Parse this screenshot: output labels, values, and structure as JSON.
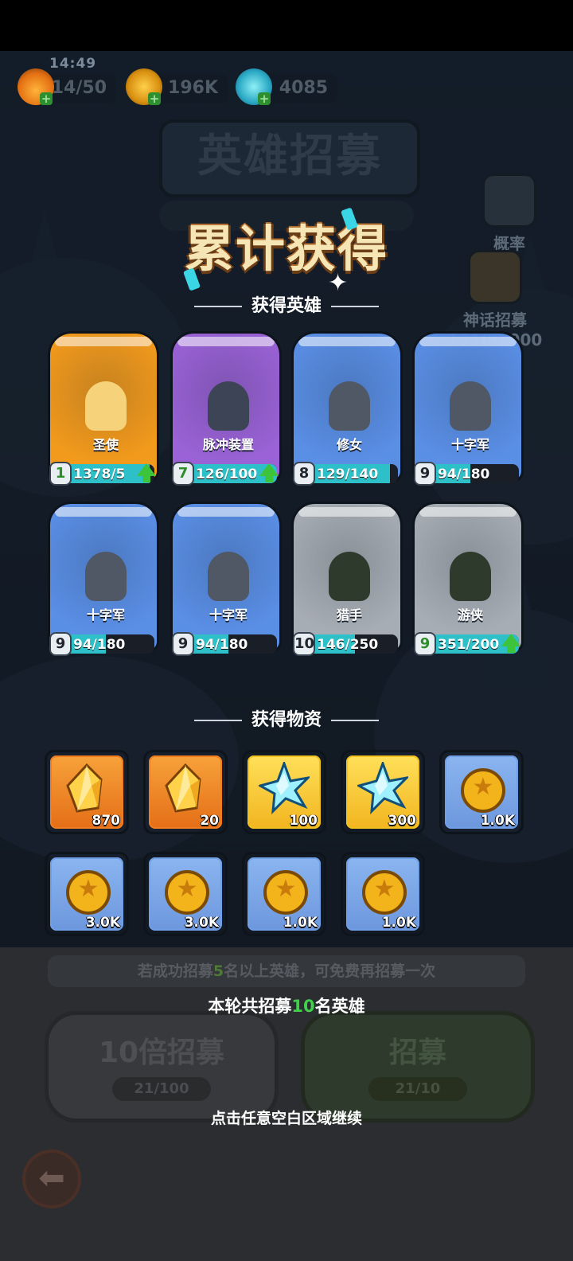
{
  "status": {
    "time": "14:49"
  },
  "resources": [
    {
      "icon": "energy-flame-icon",
      "value": "14/50"
    },
    {
      "icon": "gold-coin-icon",
      "value": "196K"
    },
    {
      "icon": "crystal-gem-icon",
      "value": "4085"
    }
  ],
  "background": {
    "title": "英雄招募",
    "side_buttons": [
      {
        "icon": "probability-doc-icon",
        "label": "概率"
      },
      {
        "icon": "mythic-crest-icon",
        "label": "神话招募",
        "progress": "1310/2000"
      }
    ]
  },
  "popup": {
    "title": "累计获得",
    "heroes_section": "获得英雄",
    "items_section": "获得物资",
    "heroes": [
      {
        "name": "圣使",
        "level": "1",
        "count": "1378/5",
        "fill": 0.95,
        "upgrade": true,
        "rarity": "legendary",
        "level_green": true
      },
      {
        "name": "脉冲装置",
        "level": "7",
        "count": "126/100",
        "fill": 1.0,
        "upgrade": true,
        "rarity": "epic",
        "level_green": true
      },
      {
        "name": "修女",
        "level": "8",
        "count": "129/140",
        "fill": 0.92,
        "upgrade": false,
        "rarity": "rare",
        "level_green": false
      },
      {
        "name": "十字军",
        "level": "9",
        "count": "94/180",
        "fill": 0.52,
        "upgrade": false,
        "rarity": "rare",
        "level_green": false
      },
      {
        "name": "十字军",
        "level": "9",
        "count": "94/180",
        "fill": 0.52,
        "upgrade": false,
        "rarity": "rare",
        "level_green": false
      },
      {
        "name": "十字军",
        "level": "9",
        "count": "94/180",
        "fill": 0.52,
        "upgrade": false,
        "rarity": "rare",
        "level_green": false
      },
      {
        "name": "猎手",
        "level": "10",
        "count": "146/250",
        "fill": 0.58,
        "upgrade": false,
        "rarity": "common",
        "level_green": false
      },
      {
        "name": "游侠",
        "level": "9",
        "count": "351/200",
        "fill": 1.0,
        "upgrade": true,
        "rarity": "common",
        "level_green": true
      }
    ],
    "items": [
      {
        "icon": "gold-crystal-icon",
        "qty": "870",
        "frame": "orange"
      },
      {
        "icon": "gold-crystal-icon",
        "qty": "20",
        "frame": "orange"
      },
      {
        "icon": "blue-snowflake-gem-icon",
        "qty": "100",
        "frame": "yellow"
      },
      {
        "icon": "blue-snowflake-gem-icon",
        "qty": "300",
        "frame": "yellow"
      },
      {
        "icon": "gold-coin-icon",
        "qty": "1.0K",
        "frame": "blue"
      },
      {
        "icon": "gold-coin-icon",
        "qty": "3.0K",
        "frame": "blue"
      },
      {
        "icon": "gold-coin-icon",
        "qty": "3.0K",
        "frame": "blue"
      },
      {
        "icon": "gold-coin-icon",
        "qty": "1.0K",
        "frame": "blue"
      },
      {
        "icon": "gold-coin-icon",
        "qty": "1.0K",
        "frame": "blue"
      }
    ]
  },
  "bottom": {
    "hint_pre": "若成功招募",
    "hint_num": "5",
    "hint_post": "名以上英雄，可免费再招募一次",
    "summary_pre": "本轮共招募",
    "summary_num": "10",
    "summary_post": "名英雄",
    "btn_ten": {
      "label": "10倍招募",
      "count": "21/100"
    },
    "btn_one": {
      "label": "招募",
      "count": "21/10"
    },
    "tap_hint": "点击任意空白区域继续"
  },
  "colors": {
    "legendary": "#f29a1c",
    "epic": "#9a62d6",
    "rare": "#5a8fe6",
    "common": "#a7adb4",
    "accent_green": "#3fd14a"
  }
}
